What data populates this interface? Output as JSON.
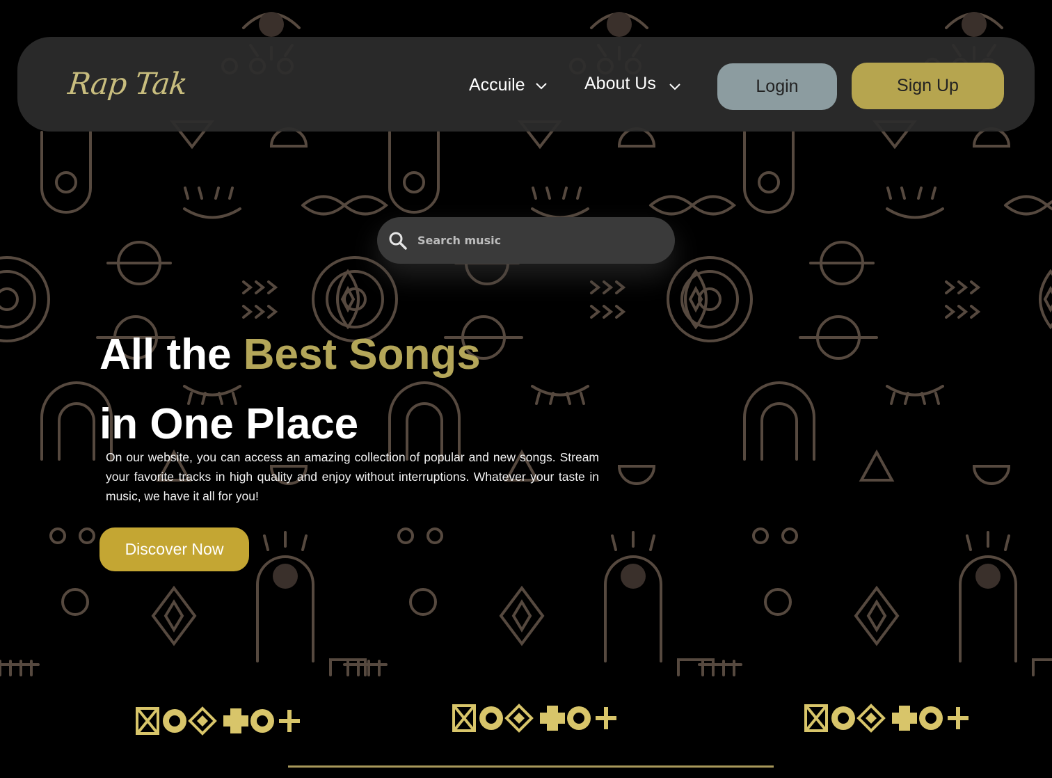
{
  "brand": {
    "logo_text": "Rap Tak"
  },
  "nav": {
    "items": [
      {
        "label": "Accuile",
        "icon": "chevron-down-icon"
      },
      {
        "label": "About Us",
        "icon": "chevron-down-icon"
      }
    ],
    "login_label": "Login",
    "signup_label": "Sign Up"
  },
  "search": {
    "placeholder": "Search music",
    "icon": "search-icon"
  },
  "hero": {
    "title_part1": "All the ",
    "title_highlight": "Best Songs",
    "title_line2": "in One Place",
    "description": "On our website, you can access an amazing collection of popular and new songs. Stream your favorite tracks in high quality and enjoy without interruptions. Whatever your taste in music, we have it all for you!",
    "cta_label": "Discover Now"
  },
  "colors": {
    "background": "#000000",
    "navbar": "#2c2c2c",
    "accent_gold": "#b6a54f",
    "login_button": "#8c9ca0",
    "cta_button": "#c4a633",
    "pattern": "#5a4f45",
    "ornament": "#d8c56a"
  }
}
